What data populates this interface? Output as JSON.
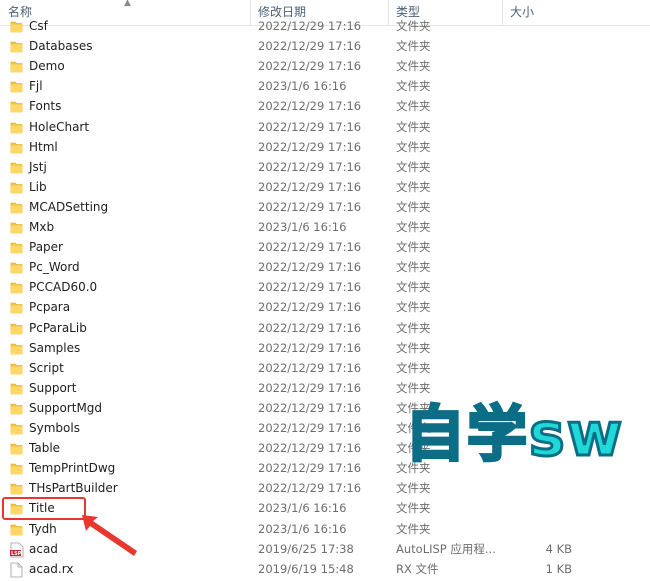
{
  "header": {
    "name": "名称",
    "date": "修改日期",
    "type": "类型",
    "size": "大小"
  },
  "files": [
    {
      "name": "Csf",
      "date": "2022/12/29 17:16",
      "type": "文件夹",
      "size": "",
      "icon": "folder-icon"
    },
    {
      "name": "Databases",
      "date": "2022/12/29 17:16",
      "type": "文件夹",
      "size": "",
      "icon": "folder-icon"
    },
    {
      "name": "Demo",
      "date": "2022/12/29 17:16",
      "type": "文件夹",
      "size": "",
      "icon": "folder-icon"
    },
    {
      "name": "Fjl",
      "date": "2023/1/6 16:16",
      "type": "文件夹",
      "size": "",
      "icon": "folder-icon"
    },
    {
      "name": "Fonts",
      "date": "2022/12/29 17:16",
      "type": "文件夹",
      "size": "",
      "icon": "folder-icon"
    },
    {
      "name": "HoleChart",
      "date": "2022/12/29 17:16",
      "type": "文件夹",
      "size": "",
      "icon": "folder-icon"
    },
    {
      "name": "Html",
      "date": "2022/12/29 17:16",
      "type": "文件夹",
      "size": "",
      "icon": "folder-icon"
    },
    {
      "name": "Jstj",
      "date": "2022/12/29 17:16",
      "type": "文件夹",
      "size": "",
      "icon": "folder-icon"
    },
    {
      "name": "Lib",
      "date": "2022/12/29 17:16",
      "type": "文件夹",
      "size": "",
      "icon": "folder-icon"
    },
    {
      "name": "MCADSetting",
      "date": "2022/12/29 17:16",
      "type": "文件夹",
      "size": "",
      "icon": "folder-icon"
    },
    {
      "name": "Mxb",
      "date": "2023/1/6 16:16",
      "type": "文件夹",
      "size": "",
      "icon": "folder-icon"
    },
    {
      "name": "Paper",
      "date": "2022/12/29 17:16",
      "type": "文件夹",
      "size": "",
      "icon": "folder-icon"
    },
    {
      "name": "Pc_Word",
      "date": "2022/12/29 17:16",
      "type": "文件夹",
      "size": "",
      "icon": "folder-icon"
    },
    {
      "name": "PCCAD60.0",
      "date": "2022/12/29 17:16",
      "type": "文件夹",
      "size": "",
      "icon": "folder-icon"
    },
    {
      "name": "Pcpara",
      "date": "2022/12/29 17:16",
      "type": "文件夹",
      "size": "",
      "icon": "folder-icon"
    },
    {
      "name": "PcParaLib",
      "date": "2022/12/29 17:16",
      "type": "文件夹",
      "size": "",
      "icon": "folder-icon"
    },
    {
      "name": "Samples",
      "date": "2022/12/29 17:16",
      "type": "文件夹",
      "size": "",
      "icon": "folder-icon"
    },
    {
      "name": "Script",
      "date": "2022/12/29 17:16",
      "type": "文件夹",
      "size": "",
      "icon": "folder-icon"
    },
    {
      "name": "Support",
      "date": "2022/12/29 17:16",
      "type": "文件夹",
      "size": "",
      "icon": "folder-icon"
    },
    {
      "name": "SupportMgd",
      "date": "2022/12/29 17:16",
      "type": "文件夹",
      "size": "",
      "icon": "folder-icon"
    },
    {
      "name": "Symbols",
      "date": "2022/12/29 17:16",
      "type": "文件夹",
      "size": "",
      "icon": "folder-icon"
    },
    {
      "name": "Table",
      "date": "2022/12/29 17:16",
      "type": "文件夹",
      "size": "",
      "icon": "folder-icon"
    },
    {
      "name": "TempPrintDwg",
      "date": "2022/12/29 17:16",
      "type": "文件夹",
      "size": "",
      "icon": "folder-icon"
    },
    {
      "name": "THsPartBuilder",
      "date": "2022/12/29 17:16",
      "type": "文件夹",
      "size": "",
      "icon": "folder-icon"
    },
    {
      "name": "Title",
      "date": "2023/1/6 16:16",
      "type": "文件夹",
      "size": "",
      "icon": "folder-icon"
    },
    {
      "name": "Tydh",
      "date": "2023/1/6 16:16",
      "type": "文件夹",
      "size": "",
      "icon": "folder-icon"
    },
    {
      "name": "acad",
      "date": "2019/6/25 17:38",
      "type": "AutoLISP 应用程...",
      "size": "4 KB",
      "icon": "lisp-file-icon"
    },
    {
      "name": "acad.rx",
      "date": "2019/6/19 15:48",
      "type": "RX 文件",
      "size": "1 KB",
      "icon": "file-icon"
    }
  ],
  "watermark": "自学sw",
  "colors": {
    "highlight": "#e8372f",
    "watermark_fill": "#20d8d8",
    "folder": "#f5c342"
  }
}
